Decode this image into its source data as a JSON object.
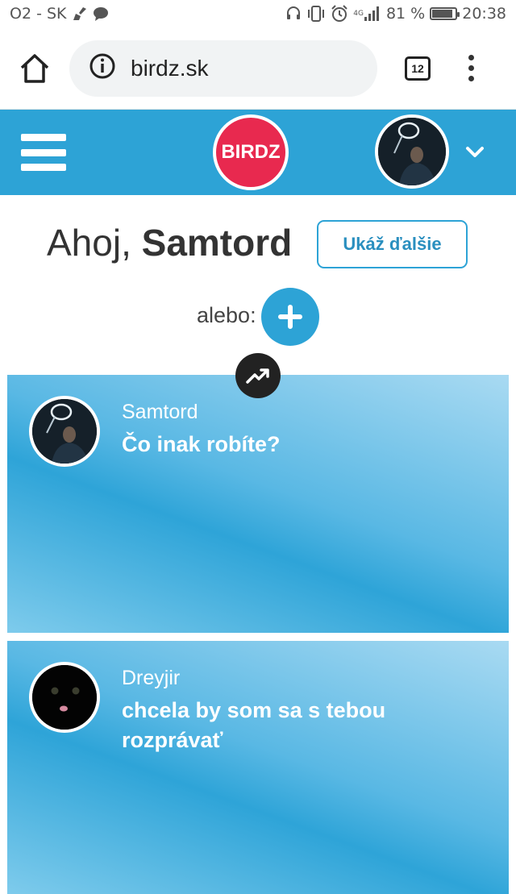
{
  "status_bar": {
    "carrier": "O2 - SK",
    "network": "4G",
    "battery_percent": "81 %",
    "battery_level": 0.81,
    "time": "20:38",
    "icons": [
      "broom-icon",
      "chat-bubble-icon",
      "headset-icon",
      "vibrate-icon",
      "alarm-icon",
      "signal-icon",
      "battery-icon"
    ]
  },
  "browser": {
    "url": "birdz.sk",
    "tab_count": "12"
  },
  "header": {
    "logo_text": "BIRDZ",
    "accent_color": "#2da3d6",
    "logo_color": "#e8294f"
  },
  "greeting": {
    "prefix": "Ahoj, ",
    "name": "Samtord",
    "more_button": "Ukáž ďalšie"
  },
  "create": {
    "or_label": "alebo:"
  },
  "feed": [
    {
      "user": "Samtord",
      "text": "Čo inak robíte?"
    },
    {
      "user": "Dreyjir",
      "text": "chcela by som sa s tebou rozprávať"
    }
  ]
}
